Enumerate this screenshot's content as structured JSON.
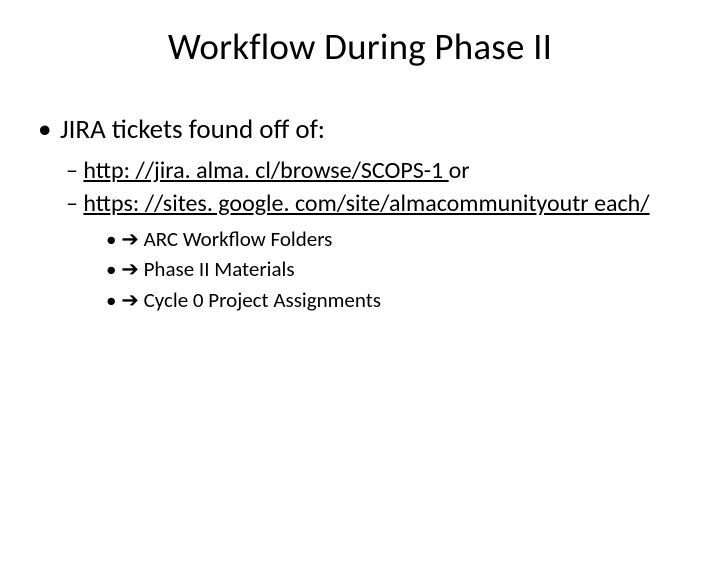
{
  "title": "Workflow During Phase II",
  "bullets": [
    {
      "text": "JIRA tickets found off of:",
      "children": [
        {
          "link": "http: //jira. alma. cl/browse/SCOPS-1 ",
          "suffix": " or"
        },
        {
          "link": "https: //sites. google. com/site/almacommunityoutr each/",
          "children": [
            {
              "text": "ARC Workflow Folders"
            },
            {
              "text": "Phase II Materials"
            },
            {
              "text": "Cycle 0 Project Assignments"
            }
          ]
        }
      ]
    }
  ]
}
